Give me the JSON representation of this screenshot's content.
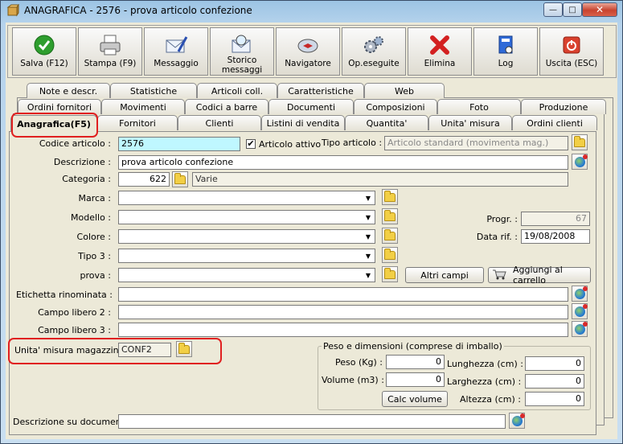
{
  "window": {
    "title": "ANAGRAFICA - 2576 - prova articolo confezione",
    "min": "—",
    "max": "□",
    "close": "✕"
  },
  "toolbar": {
    "items": [
      {
        "label": "Salva (F12)",
        "icon": "check-icon"
      },
      {
        "label": "Stampa (F9)",
        "icon": "printer-icon"
      },
      {
        "label": "Messaggio",
        "icon": "mail-pen-icon"
      },
      {
        "label": "Storico\nmessaggi",
        "icon": "mail-search-icon"
      },
      {
        "label": "Navigatore",
        "icon": "compass-icon"
      },
      {
        "label": "Op.eseguite",
        "icon": "gears-icon"
      },
      {
        "label": "Elimina",
        "icon": "x-icon"
      },
      {
        "label": "Log",
        "icon": "book-icon"
      },
      {
        "label": "Uscita (ESC)",
        "icon": "power-icon"
      }
    ]
  },
  "tabs": {
    "row1": [
      "Note e descr.",
      "Statistiche",
      "Articoli coll.",
      "Caratteristiche",
      "Web"
    ],
    "row2": [
      "Ordini fornitori",
      "Movimenti",
      "Codici a barre",
      "Documenti",
      "Composizioni",
      "Foto",
      "Produzione"
    ],
    "row3": [
      "Anagrafica(F5)",
      "Fornitori",
      "Clienti",
      "Listini di vendita",
      "Quantita'",
      "Unita' misura",
      "Ordini clienti"
    ]
  },
  "form": {
    "codice_label": "Codice articolo :",
    "codice": "2576",
    "attivo_label": "Articolo attivo",
    "attivo": "✔",
    "tipo_label": "Tipo articolo :",
    "tipo": "Articolo standard (movimenta mag.)",
    "descrizione_label": "Descrizione :",
    "descrizione": "prova articolo confezione",
    "categoria_label": "Categoria :",
    "categoria_code": "622",
    "categoria_name": "Varie",
    "marca_label": "Marca :",
    "modello_label": "Modello :",
    "colore_label": "Colore :",
    "tipo3_label": "Tipo 3 :",
    "prova_label": "prova :",
    "progr_label": "Progr. :",
    "progr": "67",
    "datarif_label": "Data rif. :",
    "datarif": "19/08/2008",
    "altri_campi": "Altri campi",
    "aggiungi_carrello": "Aggiungi al carrello",
    "etichetta_label": "Etichetta rinominata :",
    "campo2_label": "Campo libero 2 :",
    "campo3_label": "Campo libero 3 :",
    "um_label": "Unita' misura magazzino :",
    "um": "CONF2",
    "peso_group": "Peso e dimensioni (comprese di imballo)",
    "peso_label": "Peso (Kg) :",
    "peso": "0",
    "volume_label": "Volume (m3) :",
    "volume": "0",
    "lunghezza_label": "Lunghezza (cm) :",
    "lunghezza": "0",
    "larghezza_label": "Larghezza (cm) :",
    "larghezza": "0",
    "altezza_label": "Altezza (cm) :",
    "altezza": "0",
    "calc_volume": "Calc volume",
    "descdoc_label": "Descrizione su documenti :",
    "descdoc": ""
  },
  "colors": {
    "highlight": "#e02020",
    "codice_bg": "#bff7ff"
  }
}
